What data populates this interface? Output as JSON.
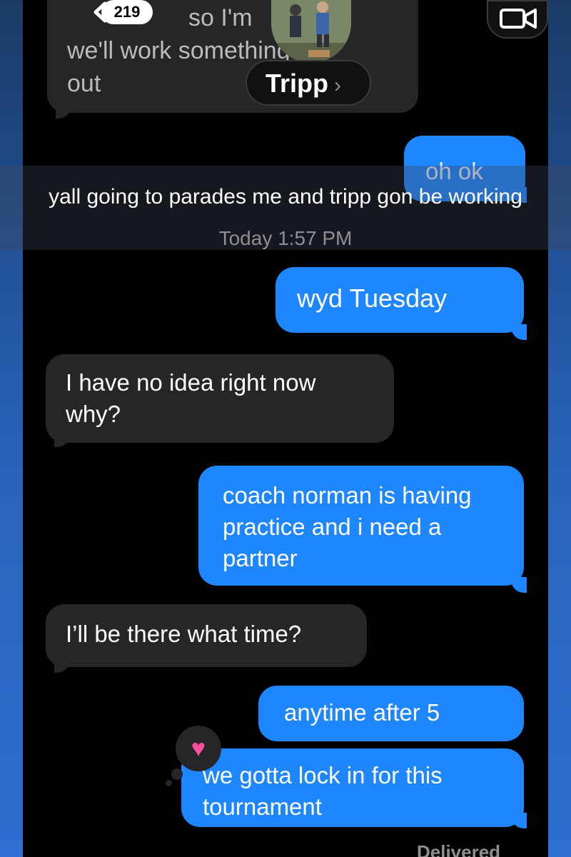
{
  "header": {
    "back_count": "219",
    "contact_name": "Tripp",
    "contact_chevron": "›",
    "icons": {
      "back": "chevron-left-icon",
      "video": "video-camera-icon"
    }
  },
  "top_message": {
    "line1": "so I'm",
    "line2": "we'll work something",
    "line3": "out"
  },
  "messages": [
    {
      "dir": "out",
      "text": "oh ok"
    },
    {
      "dir": "out",
      "text": "wyd Tuesday"
    },
    {
      "dir": "in",
      "text": "I have no idea right now why?"
    },
    {
      "dir": "out",
      "text": "coach norman is having practice and i need a partner"
    },
    {
      "dir": "in",
      "text": "I’ll be there what time?"
    },
    {
      "dir": "out",
      "text": "anytime after 5"
    },
    {
      "dir": "out",
      "text": "we gotta lock in for this tournament"
    }
  ],
  "caption": "yall going to parades me and tripp gon be working",
  "timestamp": "Today 1:57 PM",
  "reaction": "♥",
  "status": "Delivered",
  "colors": {
    "outgoing_bubble": "#1e86ff",
    "incoming_bubble": "#262629",
    "background": "#000000",
    "reaction": "#ff4fa0"
  }
}
